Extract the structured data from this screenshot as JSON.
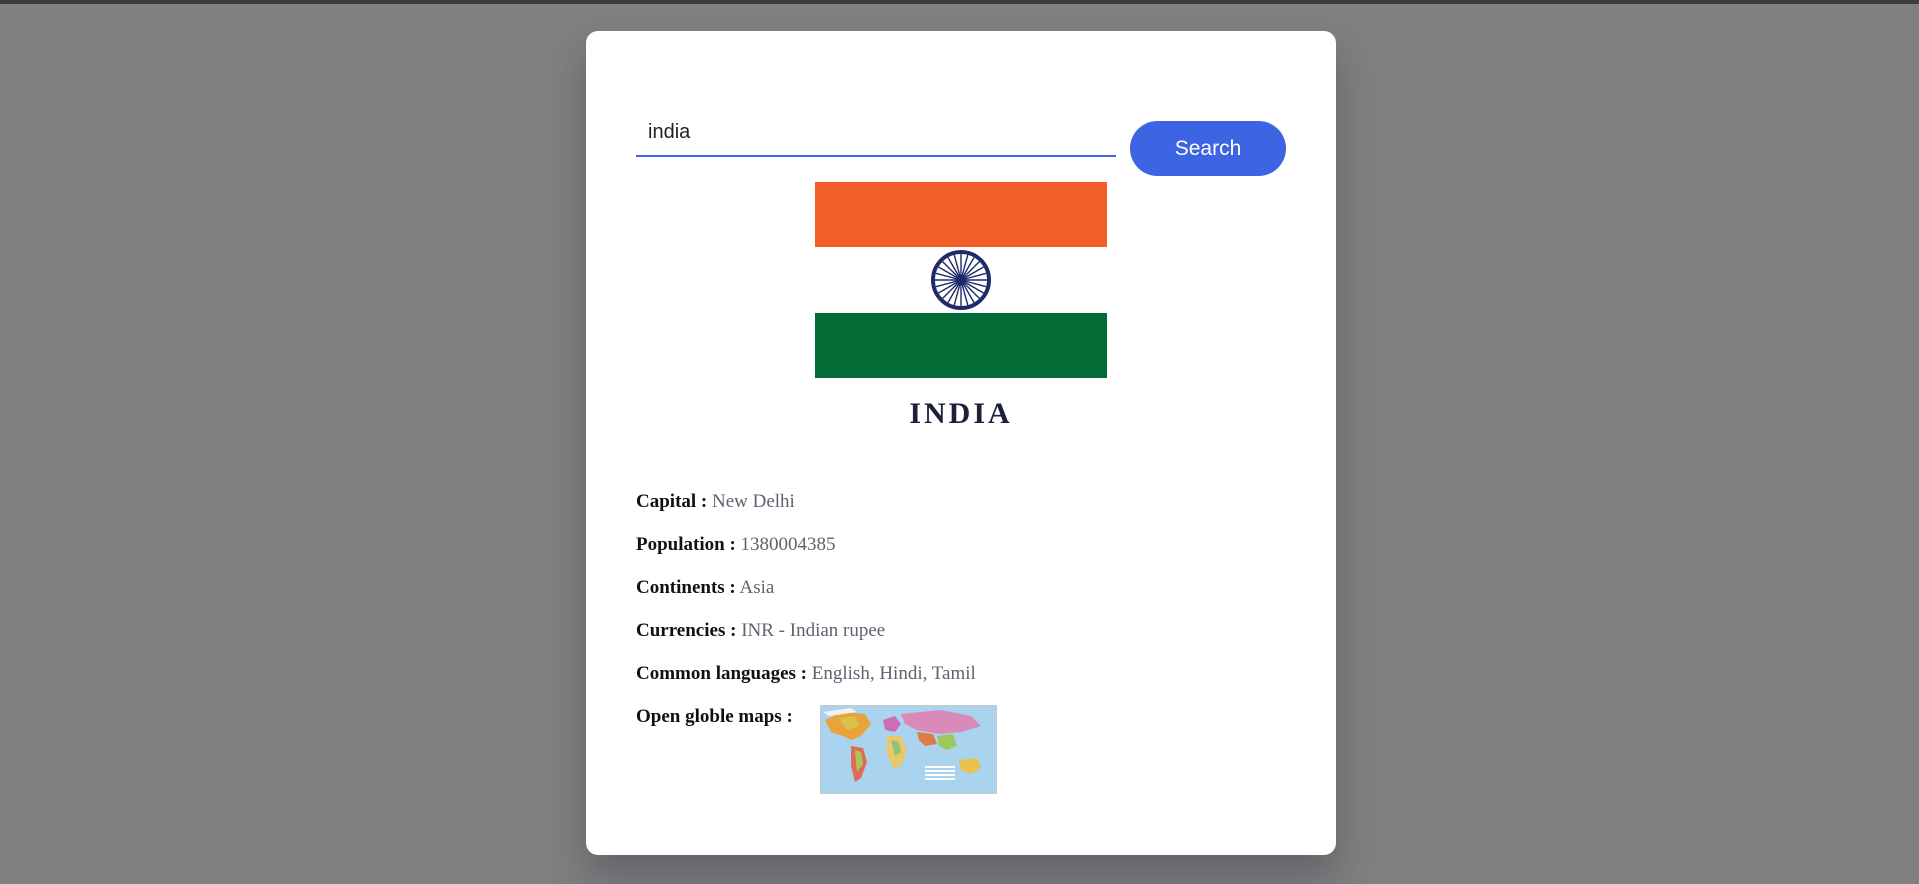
{
  "search": {
    "value": "india",
    "button_label": "Search"
  },
  "country": {
    "name": "INDIA",
    "flag_colors": {
      "saffron": "#f25e27",
      "white": "#ffffff",
      "green": "#036b36",
      "chakra": "#1f2a6a"
    }
  },
  "details": [
    {
      "label": "Capital :",
      "value": "New Delhi"
    },
    {
      "label": "Population :",
      "value": "1380004385"
    },
    {
      "label": "Continents :",
      "value": "Asia"
    },
    {
      "label": "Currencies :",
      "value": "INR - Indian rupee"
    },
    {
      "label": "Common languages :",
      "value": "English, Hindi, Tamil"
    }
  ],
  "maps": {
    "label": "Open globle maps :"
  },
  "colors": {
    "backdrop": "#808080",
    "accent": "#3d64e3"
  }
}
